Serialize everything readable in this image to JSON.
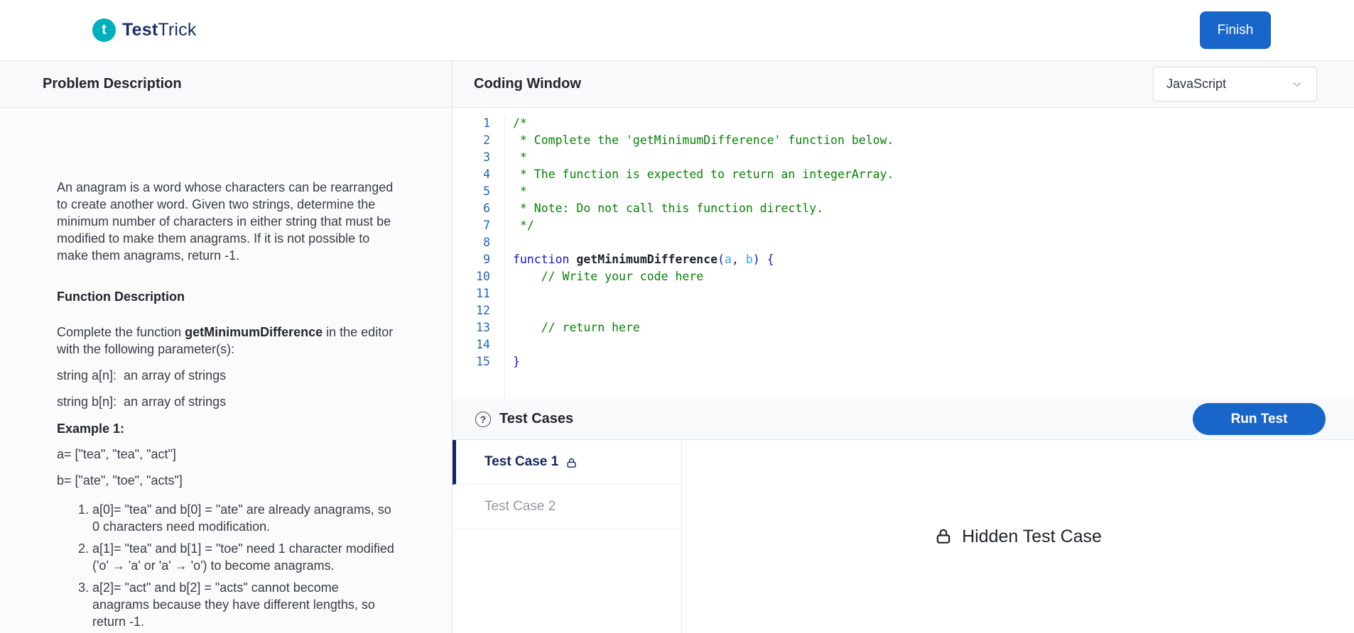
{
  "header": {
    "brand": {
      "icon_letter": "t",
      "name_bold": "Test",
      "name_light": "Trick"
    },
    "finish_button": "Finish"
  },
  "problem": {
    "title": "Problem Description",
    "intro": "An anagram is a word whose characters can be rearranged to create another word. Given two strings, determine the minimum number of characters in either string that must be modified to make them anagrams. If it is not possible to make them anagrams, return -1.",
    "function_description_heading": "Function Description",
    "complete_prefix": "Complete the function ",
    "function_name": "getMinimumDifference",
    "complete_suffix": " in the editor with the following parameter(s):",
    "params": [
      "string a[n]:  an array of strings",
      "string b[n]:  an array of strings"
    ],
    "example_heading": "Example 1:",
    "example_a": "a= [\"tea\", \"tea\", \"act\"]",
    "example_b": "b= [\"ate\", \"toe\", \"acts\"]",
    "example_items": [
      "a[0]= \"tea\" and b[0] = \"ate\" are already anagrams, so 0 characters need modification.",
      "a[1]= \"tea\" and b[1] = \"toe\" need 1 character modified ('o' → 'a' or 'a' → 'o') to become anagrams.",
      "a[2]= \"act\" and b[2] = \"acts\" cannot become anagrams because they have different lengths, so return -1."
    ]
  },
  "coding": {
    "title": "Coding Window",
    "language_select": "JavaScript",
    "lines": [
      {
        "n": "1",
        "tokens": [
          {
            "t": "/*",
            "c": "com"
          }
        ]
      },
      {
        "n": "2",
        "tokens": [
          {
            "t": " * Complete the 'getMinimumDifference' function below.",
            "c": "com"
          }
        ]
      },
      {
        "n": "3",
        "tokens": [
          {
            "t": " *",
            "c": "com"
          }
        ]
      },
      {
        "n": "4",
        "tokens": [
          {
            "t": " * The function is expected to return an integerArray.",
            "c": "com"
          }
        ]
      },
      {
        "n": "5",
        "tokens": [
          {
            "t": " *",
            "c": "com"
          }
        ]
      },
      {
        "n": "6",
        "tokens": [
          {
            "t": " * Note: Do not call this function directly.",
            "c": "com"
          }
        ]
      },
      {
        "n": "7",
        "tokens": [
          {
            "t": " */",
            "c": "com"
          }
        ]
      },
      {
        "n": "8",
        "tokens": []
      },
      {
        "n": "9",
        "tokens": [
          {
            "t": "function",
            "c": "kw"
          },
          {
            "t": " ",
            "c": "plain"
          },
          {
            "t": "getMinimumDifference",
            "c": "id"
          },
          {
            "t": "(",
            "c": "punc"
          },
          {
            "t": "a",
            "c": "param"
          },
          {
            "t": ", ",
            "c": "plain"
          },
          {
            "t": "b",
            "c": "param"
          },
          {
            "t": ")",
            "c": "punc"
          },
          {
            "t": " ",
            "c": "plain"
          },
          {
            "t": "{",
            "c": "punc"
          }
        ]
      },
      {
        "n": "10",
        "tokens": [
          {
            "t": "    // Write your code here",
            "c": "com"
          }
        ]
      },
      {
        "n": "11",
        "tokens": []
      },
      {
        "n": "12",
        "tokens": []
      },
      {
        "n": "13",
        "tokens": [
          {
            "t": "    // return here",
            "c": "com"
          }
        ]
      },
      {
        "n": "14",
        "tokens": []
      },
      {
        "n": "15",
        "tokens": [
          {
            "t": "}",
            "c": "punc"
          }
        ]
      }
    ]
  },
  "tests": {
    "title": "Test Cases",
    "run_button": "Run Test",
    "cases": [
      {
        "label": "Test Case 1",
        "locked": true,
        "active": true
      },
      {
        "label": "Test Case 2",
        "locked": false,
        "active": false
      }
    ],
    "hidden_label": "Hidden Test Case"
  },
  "colors": {
    "accent_blue": "#1866c9",
    "brand_teal": "#00aebc",
    "brand_navy": "#1d3066",
    "active_case_navy": "#14265c",
    "comment_green": "#068206",
    "keyword_blue": "#1414d2",
    "param_blue": "#3ba3dc",
    "line_number_blue": "#1f66b8"
  }
}
